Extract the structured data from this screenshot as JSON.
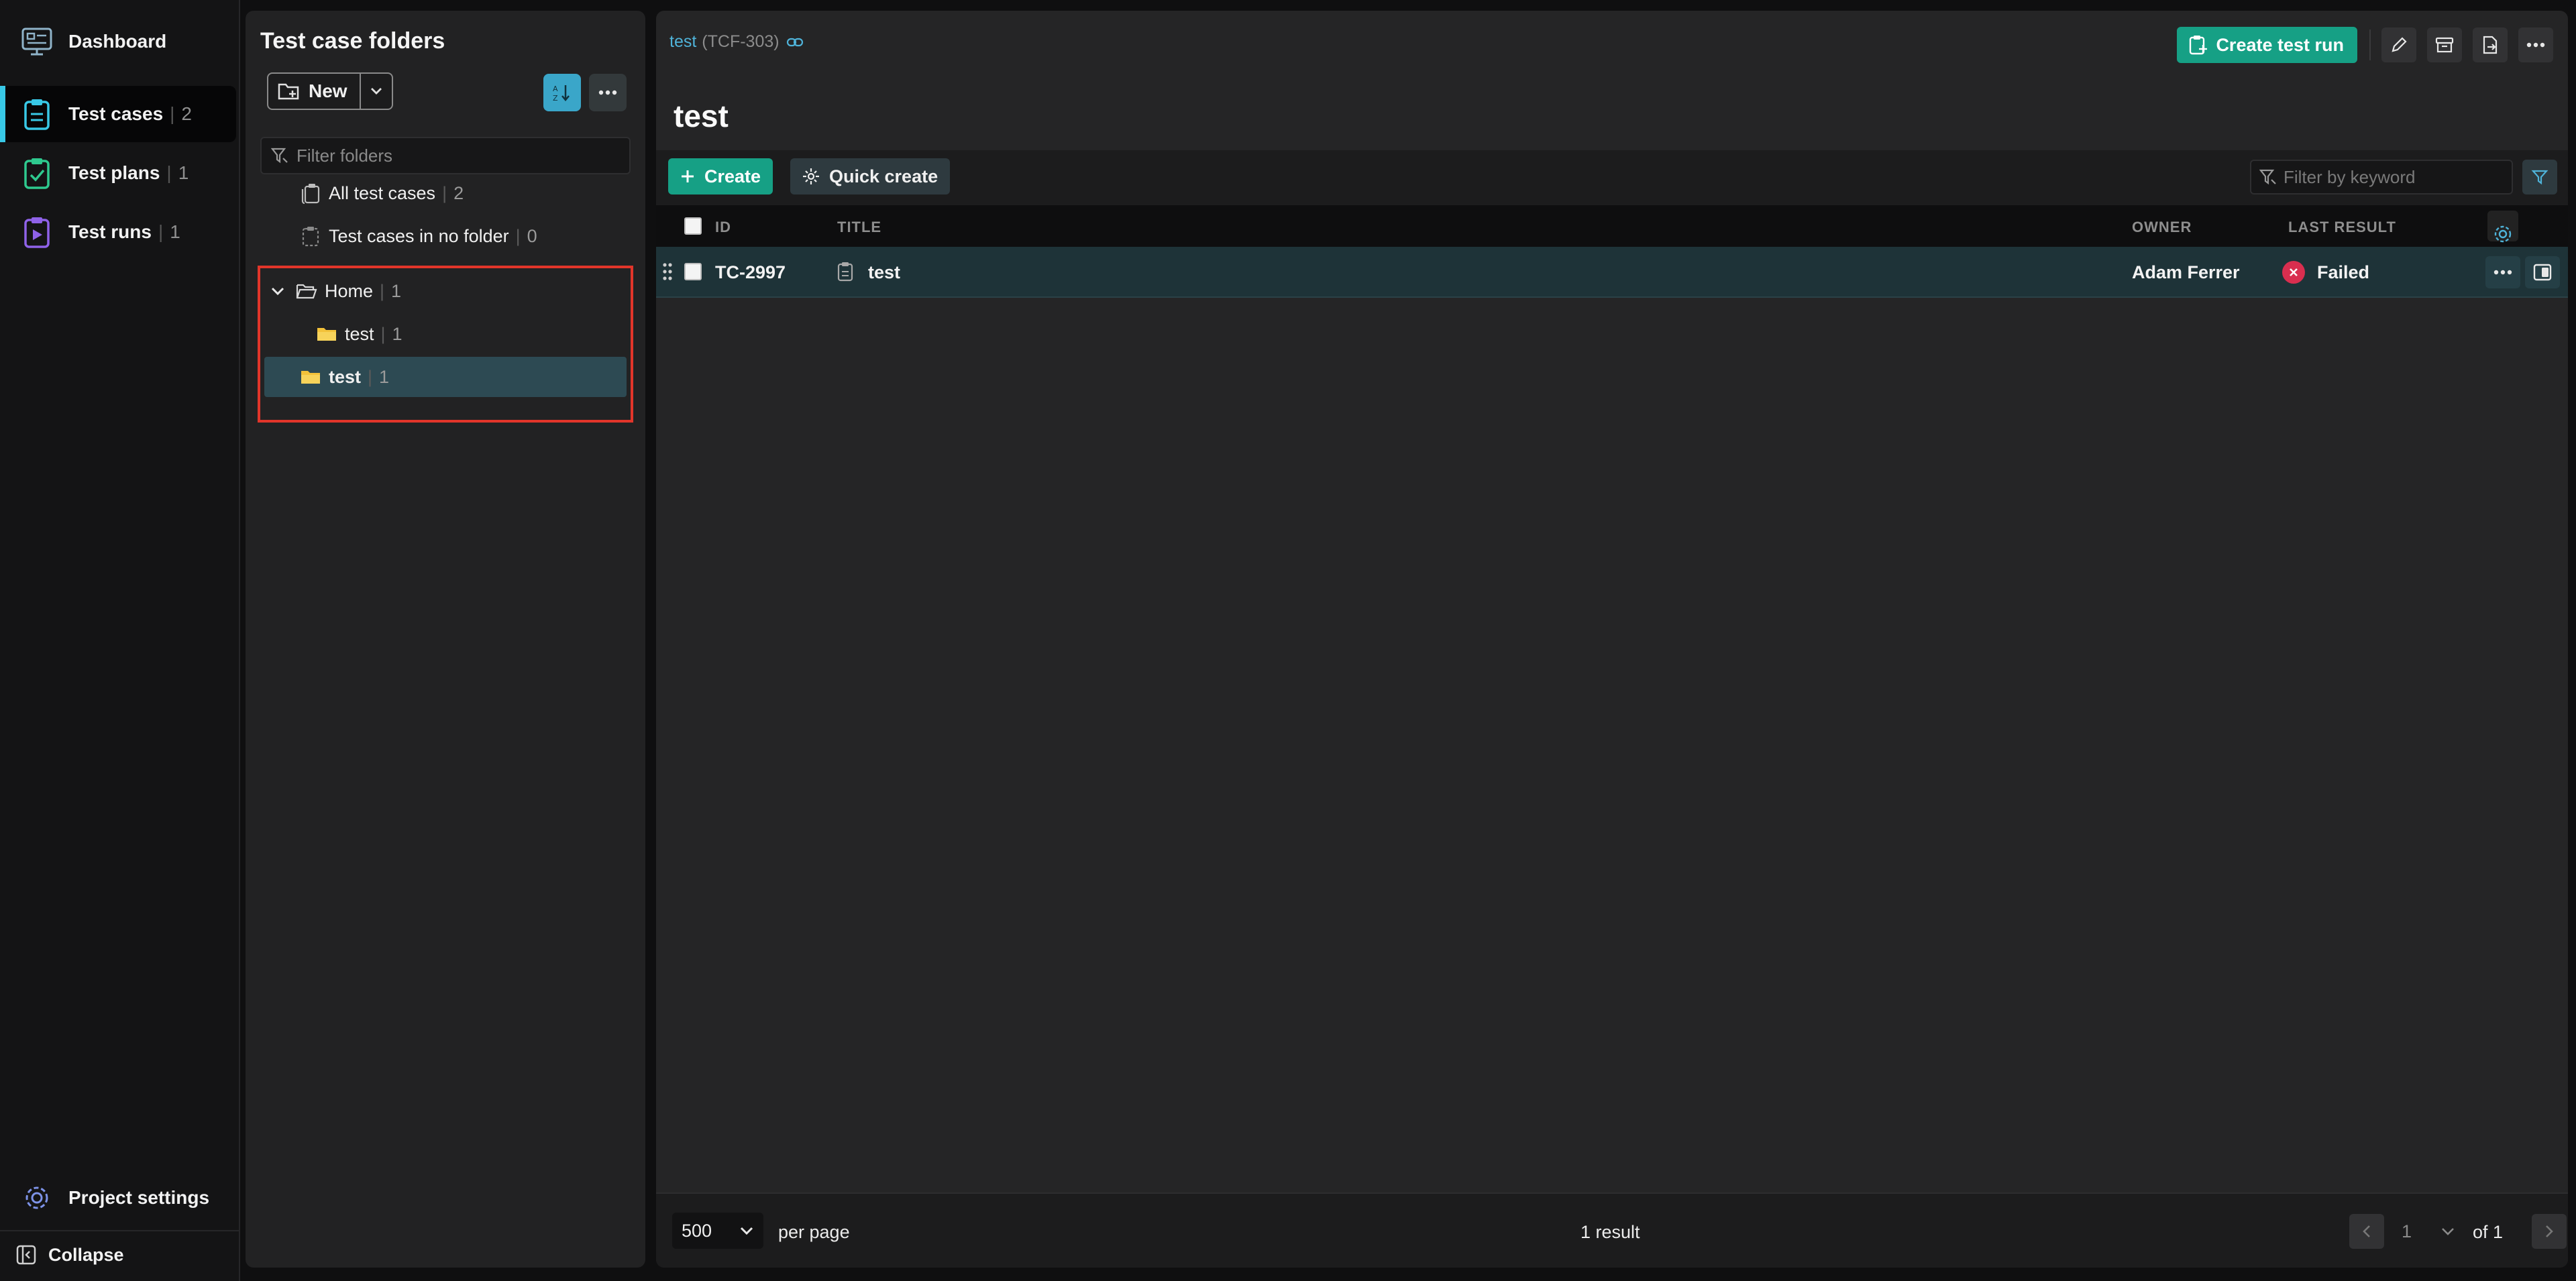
{
  "nav": {
    "dashboard": "Dashboard",
    "items": [
      {
        "label": "Test cases",
        "count": "2"
      },
      {
        "label": "Test plans",
        "count": "1"
      },
      {
        "label": "Test runs",
        "count": "1"
      }
    ],
    "settings": "Project settings",
    "collapse": "Collapse"
  },
  "folders": {
    "title": "Test case folders",
    "new_label": "New",
    "filter_placeholder": "Filter folders",
    "all": {
      "label": "All test cases",
      "count": "2"
    },
    "nofolder": {
      "label": "Test cases in no folder",
      "count": "0"
    },
    "tree": [
      {
        "label": "Home",
        "count": "1"
      },
      {
        "label": "test",
        "count": "1"
      },
      {
        "label": "test",
        "count": "1"
      }
    ]
  },
  "main": {
    "crumb_link": "test",
    "crumb_key": "(TCF-303)",
    "create_run": "Create test run",
    "title": "test",
    "create": "Create",
    "quick_create": "Quick create",
    "keyword_placeholder": "Filter by keyword",
    "columns": {
      "id": "ID",
      "title": "TITLE",
      "owner": "OWNER",
      "last_result": "LAST RESULT"
    },
    "rows": [
      {
        "id": "TC-2997",
        "title": "test",
        "owner": "Adam Ferrer",
        "result": "Failed"
      }
    ],
    "footer": {
      "per_page_value": "500",
      "per_page": "per page",
      "result_count": "1 result",
      "page": "1",
      "of_pages": "of 1"
    }
  },
  "colors": {
    "accent": "#16a085",
    "active_nav": "#38c8e6",
    "failed": "#d92e4f",
    "highlight": "#e2352a"
  }
}
